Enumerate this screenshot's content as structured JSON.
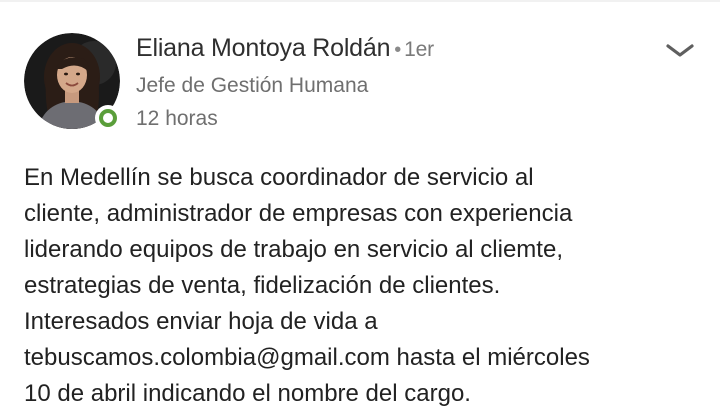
{
  "author": {
    "name": "Eliana Montoya Roldán",
    "separator": "•",
    "degree": "1er",
    "title": "Jefe de Gestión Humana",
    "presence_color": "#5a9e3a"
  },
  "post": {
    "time": "12 horas",
    "menu_icon": "chevron-down-icon",
    "body_lines": [
      "En Medellín se busca coordinador de servicio al",
      "cliente, administrador de empresas con experiencia",
      "liderando equipos de trabajo en servicio al cliemte,",
      "estrategias de venta, fidelización de clientes.",
      "Interesados enviar hoja de vida a",
      "tebuscamos.colombia@gmail.com hasta el miércoles",
      "10 de abril indicando el nombre del cargo."
    ]
  }
}
